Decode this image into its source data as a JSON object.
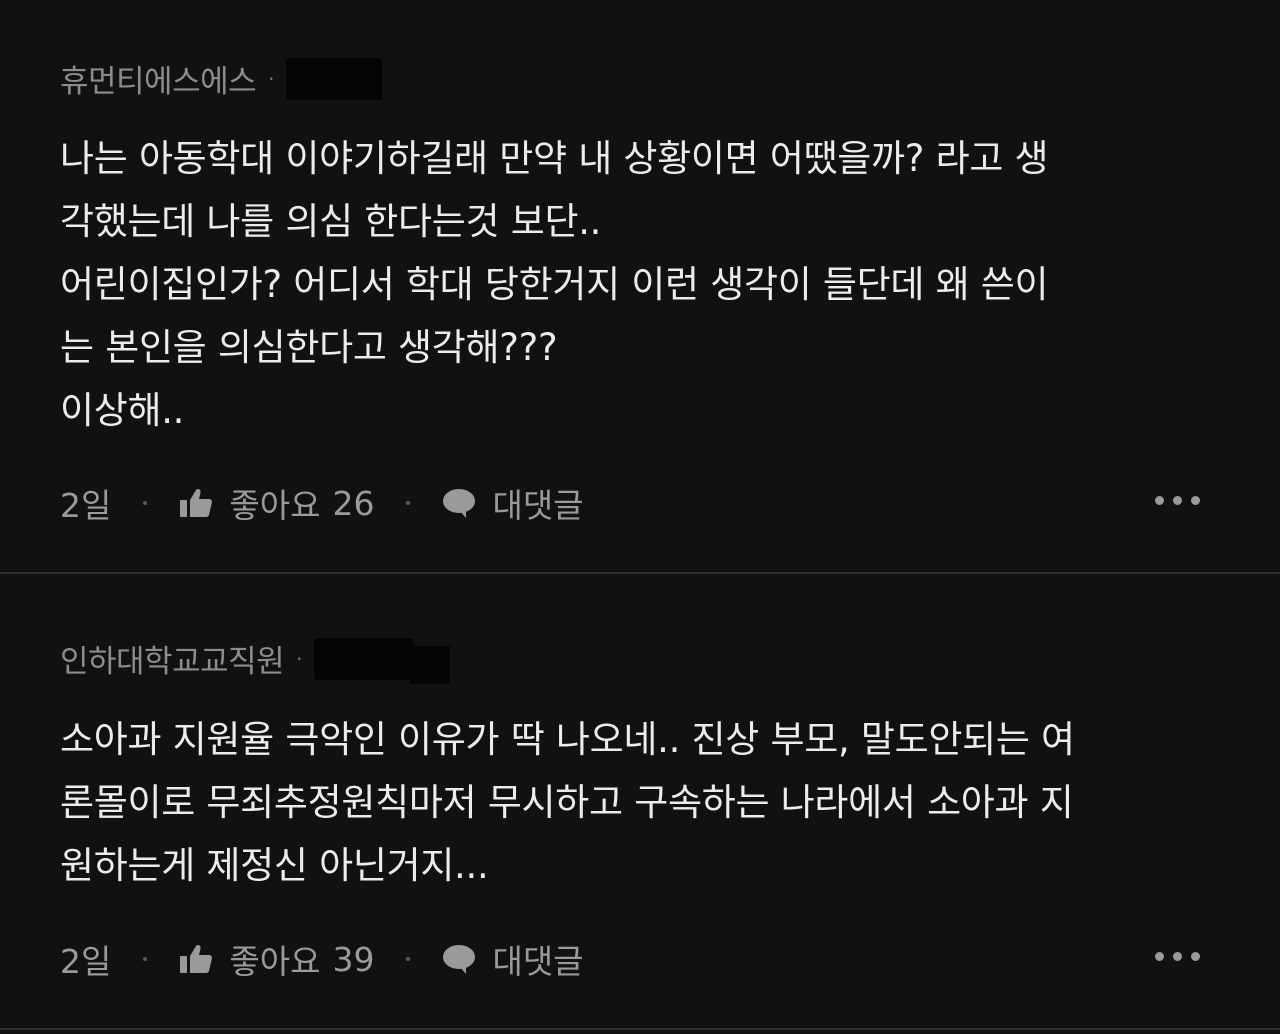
{
  "comments": [
    {
      "author": "휴먼티에스에스",
      "body": "나는 아동학대 이야기하길래 만약 내 상황이면 어땠을까? 라고 생\n각했는데 나를 의심 한다는것 보단..\n어린이집인가? 어디서 학대 당한거지 이런 생각이 들단데 왜 쓴이\n는 본인을 의심한다고 생각해???\n이상해..",
      "time": "2일",
      "like_label": "좋아요",
      "like_count": "26",
      "reply_label": "대댓글"
    },
    {
      "author": "인하대학교교직원",
      "body": "소아과 지원율 극악인 이유가 딱 나오네.. 진상 부모, 말도안되는 여\n론몰이로 무죄추정원칙마저 무시하고 구속하는 나라에서 소아과 지\n원하는게 제정신 아닌거지...",
      "time": "2일",
      "like_label": "좋아요",
      "like_count": "39",
      "reply_label": "대댓글"
    }
  ],
  "icons": {
    "like": "thumbs-up-icon",
    "reply": "speech-bubble-icon",
    "more": "more-options-icon"
  },
  "colors": {
    "background": "#111111",
    "text": "#ececec",
    "meta": "#8c8c8c",
    "divider": "#2e2e2e"
  }
}
